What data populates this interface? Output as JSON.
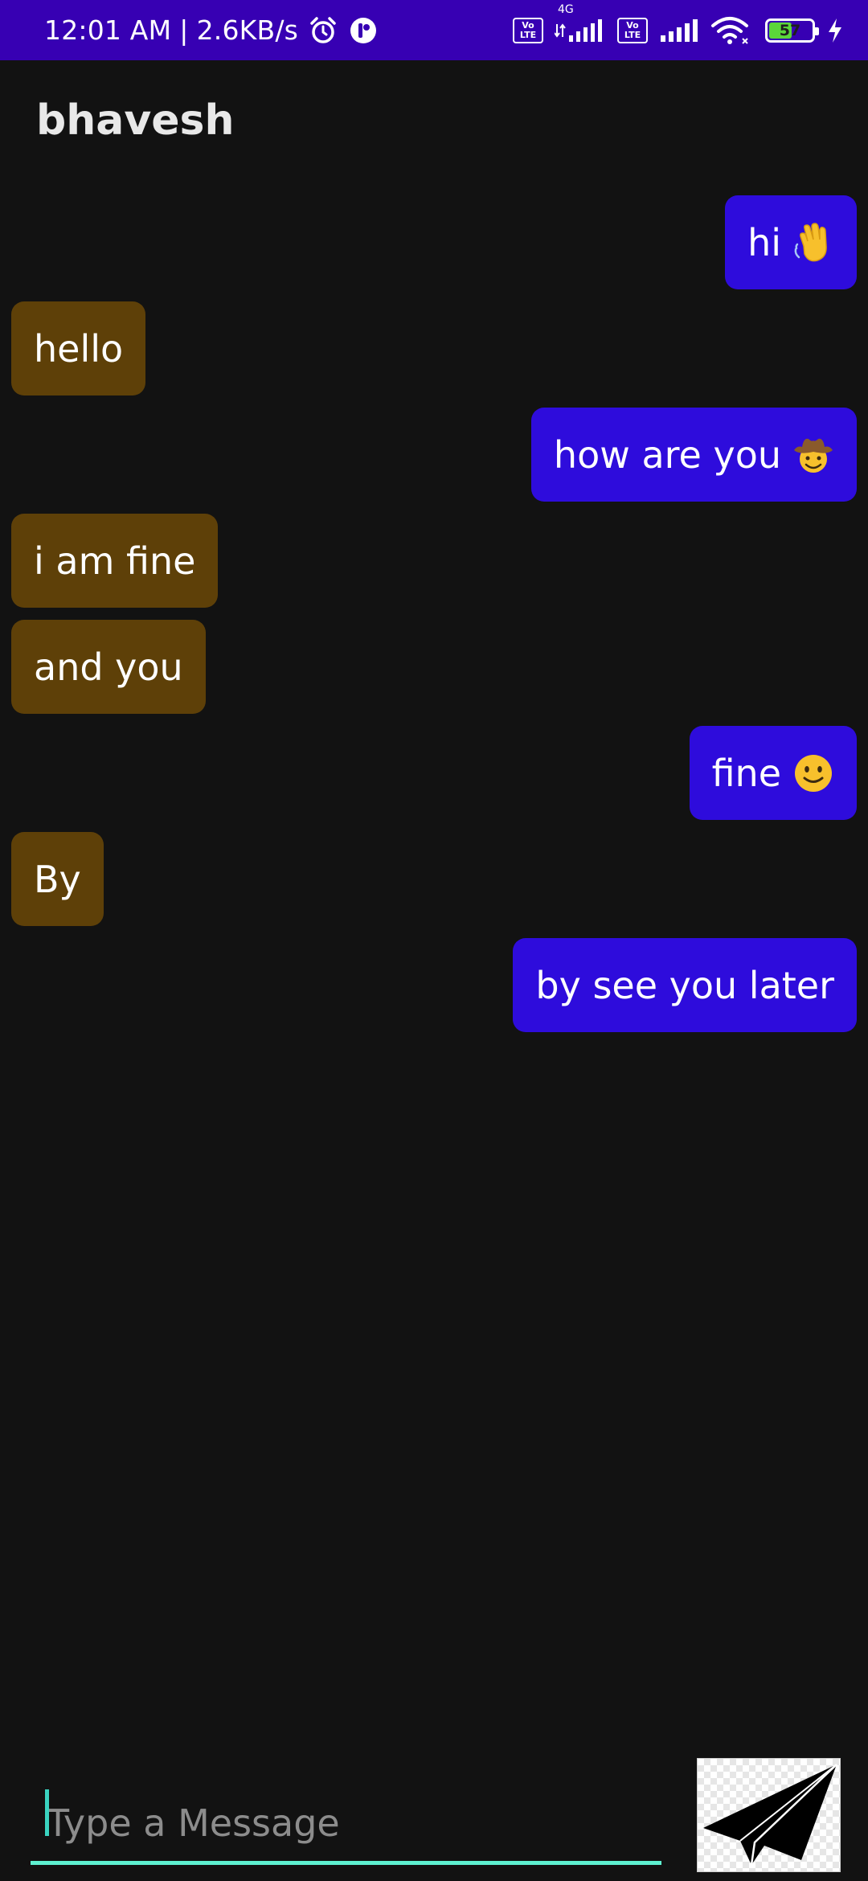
{
  "status_bar": {
    "time": "12:01 AM",
    "separator": "|",
    "speed": "2.6KB/s",
    "network_type": "4G",
    "volte_label_top": "Vo",
    "volte_label_bottom": "LTE",
    "battery_percent": "57",
    "battery_level": 0.57,
    "icons": [
      "alarm-icon",
      "app-notification-icon",
      "volte-icon",
      "signal-icon",
      "wifi-icon",
      "battery-icon",
      "charging-icon"
    ]
  },
  "header": {
    "contact_name": "bhavesh"
  },
  "colors": {
    "status_bar": "#3700b3",
    "background": "#121212",
    "outgoing_bubble": "#2e0cdc",
    "incoming_bubble": "#5e4008",
    "input_underline": "#5ef0d0"
  },
  "messages": [
    {
      "direction": "out",
      "text": "hi",
      "emoji": "wave-emoji"
    },
    {
      "direction": "in",
      "text": "hello"
    },
    {
      "direction": "out",
      "text": "how are you",
      "emoji": "cowboy-emoji"
    },
    {
      "direction": "in",
      "text": "i am fine"
    },
    {
      "direction": "in",
      "text": "and you"
    },
    {
      "direction": "out",
      "text": "fine",
      "emoji": "smile-emoji"
    },
    {
      "direction": "in",
      "text": "By"
    },
    {
      "direction": "out",
      "text": "by see you later"
    }
  ],
  "composer": {
    "placeholder": "Type a Message",
    "value": "",
    "send_icon": "paper-plane-icon"
  }
}
